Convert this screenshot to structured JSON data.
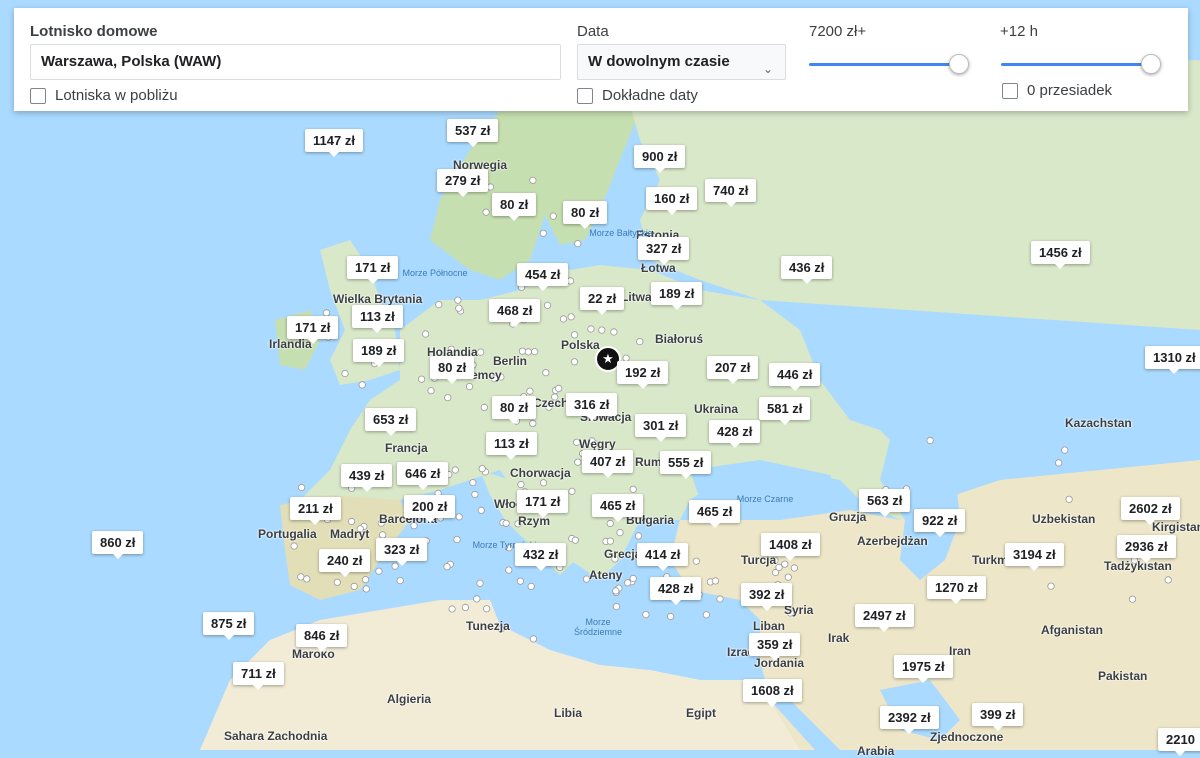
{
  "search": {
    "origin_label": "Lotnisko domowe",
    "origin_value": "Warszawa, Polska (WAW)",
    "nearby_label": "Lotniska w pobliżu",
    "date_label": "Data",
    "date_value": "W dowolnym czasie",
    "exact_dates_label": "Dokładne daty",
    "price_label": "7200 zł+",
    "price_fraction": 1.0,
    "duration_label": "+12 h",
    "duration_fraction": 1.0,
    "stops_label": "0 przesiadek"
  },
  "colors": {
    "sea": "#aadaff",
    "land": "#d8e8c8",
    "land_green": "#c6dfb0",
    "desert": "#f2ecd7",
    "accent": "#4285f4"
  },
  "prices": [
    "537 zł",
    "1147 zł",
    "900 zł",
    "279 zł",
    "80 zł",
    "80 zł",
    "160 zł",
    "740 zł",
    "327 zł",
    "1456 zł",
    "171 zł",
    "454 zł",
    "436 zł",
    "22 zł",
    "189 zł",
    "468 zł",
    "171 zł",
    "113 zł",
    "189 zł",
    "80 zł",
    "192 zł",
    "207 zł",
    "446 zł",
    "1310 zł",
    "80 zł",
    "316 zł",
    "581 zł",
    "653 zł",
    "301 zł",
    "428 zł",
    "113 zł",
    "407 zł",
    "555 zł",
    "439 zł",
    "646 zł",
    "171 zł",
    "465 zł",
    "465 zł",
    "563 zł",
    "2602 zł",
    "211 zł",
    "200 zł",
    "922 zł",
    "2936 zł",
    "860 zł",
    "323 zł",
    "432 zł",
    "414 zł",
    "1408 zł",
    "3194 zł",
    "240 zł",
    "428 zł",
    "1270 zł",
    "392 zł",
    "875 zł",
    "846 zł",
    "2497 zł",
    "359 zł",
    "711 zł",
    "1975 zł",
    "1608 zł",
    "399 zł",
    "2392 zł",
    "2210"
  ],
  "places": [
    "Norwegia",
    "Estonia",
    "Łotwa",
    "Litwa",
    "Wielka Brytania",
    "Irlandia",
    "Białoruś",
    "Polska",
    "Holandia",
    "Berlin",
    "Niemcy",
    "Czechy",
    "Słowacja",
    "Ukraina",
    "Francja",
    "Węgry",
    "Rumunia",
    "Kazachstan",
    "Chorwacja",
    "Barcelona",
    "Madryt",
    "Portugalia",
    "Włochy",
    "Rzym",
    "Bułgaria",
    "Gruzja",
    "Uzbekistan",
    "Kirgistan",
    "Azerbejdżan",
    "Turkmenistan",
    "Tadżykistan",
    "Grecja",
    "Turcja",
    "Syria",
    "Liban",
    "Irak",
    "Izrael",
    "Jordania",
    "Afganistan",
    "Iran",
    "Pakistan",
    "Maroko",
    "Tunezja",
    "Algieria",
    "Libia",
    "Egipt",
    "Sahara Zachodnia",
    "Arabia",
    "Zjednoczone",
    "Ateny"
  ],
  "seas": [
    "Morze Północne",
    "Morze Bałtyckie",
    "Morze Czarne",
    "Morze Tyrreńskie",
    "Morze Śródziemne"
  ]
}
